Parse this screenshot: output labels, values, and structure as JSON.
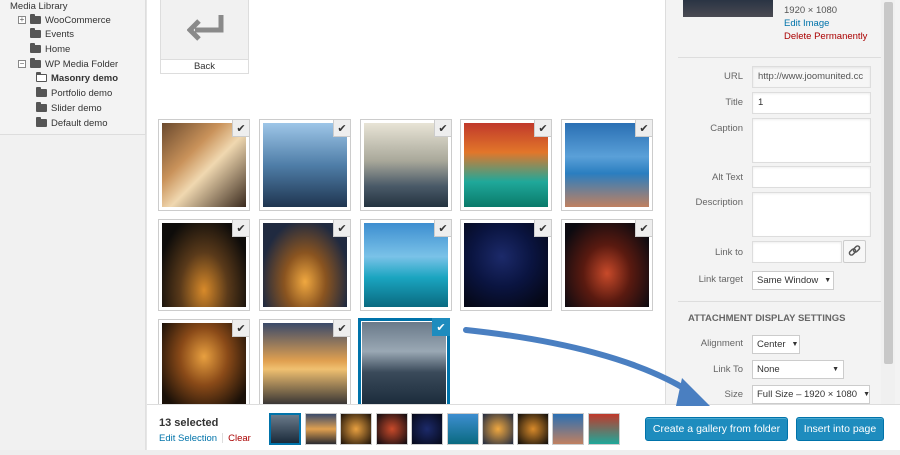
{
  "tree": {
    "title": "Media Library",
    "items": [
      {
        "label": "WooCommerce",
        "expander": "+"
      },
      {
        "label": "Events"
      },
      {
        "label": "Home"
      },
      {
        "label": "WP Media Folder",
        "expander": "−"
      },
      {
        "label": "Masonry demo",
        "active": true
      },
      {
        "label": "Portfolio demo"
      },
      {
        "label": "Slider demo"
      },
      {
        "label": "Default demo"
      }
    ]
  },
  "back": {
    "label": "Back"
  },
  "thumbnails": [
    {
      "subject": "florence-street",
      "checked": true
    },
    {
      "subject": "new-york-skyline",
      "checked": true
    },
    {
      "subject": "london-parliament",
      "checked": true
    },
    {
      "subject": "venice-canal",
      "checked": true
    },
    {
      "subject": "wooden-pier-sea",
      "checked": true
    },
    {
      "subject": "city-night-aerial",
      "checked": true
    },
    {
      "subject": "paris-night-eiffel",
      "checked": true
    },
    {
      "subject": "pier-blue-lake",
      "checked": true
    },
    {
      "subject": "london-eye-night",
      "checked": true
    },
    {
      "subject": "street-bokeh-lights",
      "checked": true
    },
    {
      "subject": "city-lights-bokeh",
      "checked": true
    },
    {
      "subject": "sunset-skyline",
      "checked": true
    },
    {
      "subject": "brooklyn-bridge",
      "checked": true,
      "selected_details": true
    }
  ],
  "details": {
    "dimensions": "1920 × 1080",
    "edit_image": "Edit Image",
    "delete": "Delete Permanently",
    "url_label": "URL",
    "url_value": "http://www.joomunited.cc",
    "title_label": "Title",
    "title_value": "1",
    "caption_label": "Caption",
    "alt_label": "Alt Text",
    "description_label": "Description",
    "link_to_label": "Link to",
    "link_target_label": "Link target",
    "link_target_value": "Same Window"
  },
  "display_settings": {
    "heading": "Attachment Display Settings",
    "alignment_label": "Alignment",
    "alignment_value": "Center",
    "link_to_label": "Link To",
    "link_to_value": "None",
    "size_label": "Size",
    "size_value": "Full Size – 1920 × 1080"
  },
  "toolbar": {
    "selected_count": "13 selected",
    "edit_selection": "Edit Selection",
    "clear": "Clear",
    "gallery_button": "Create a gallery from folder",
    "insert_button": "Insert into page"
  },
  "colors": {
    "accent": "#1e8cbe",
    "accent_border": "#0073aa",
    "danger": "#a00",
    "annotation_arrow": "#4a7fc1"
  }
}
